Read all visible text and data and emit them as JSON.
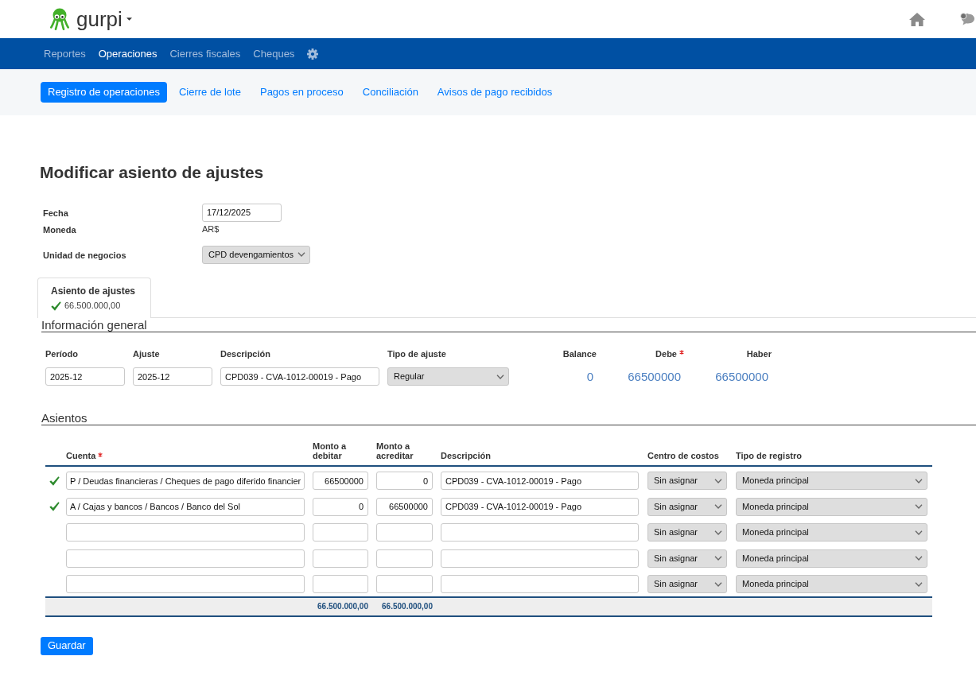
{
  "header": {
    "brand": "gurpi"
  },
  "main_nav": [
    {
      "label": "Reportes",
      "selected": false
    },
    {
      "label": "Operaciones",
      "selected": true
    },
    {
      "label": "Cierres fiscales",
      "selected": false
    },
    {
      "label": "Cheques",
      "selected": false
    }
  ],
  "sub_nav": [
    {
      "label": "Registro de operaciones",
      "selected": true
    },
    {
      "label": "Cierre de lote",
      "selected": false
    },
    {
      "label": "Pagos en proceso",
      "selected": false
    },
    {
      "label": "Conciliación",
      "selected": false
    },
    {
      "label": "Avisos de pago recibidos",
      "selected": false
    }
  ],
  "page_title": "Modificar asiento de ajustes",
  "form_fields": [
    {
      "kind": "input",
      "label": "Fecha",
      "value": "17/12/2025"
    },
    {
      "kind": "text",
      "label": "Moneda",
      "value": "AR$"
    },
    {
      "kind": "select",
      "label": "Unidad de negocios",
      "value": "CPD devengamientos"
    }
  ],
  "entry_tabs": [
    {
      "title": "Asiento de ajustes",
      "amount": "66.500.000,00",
      "valid": true,
      "selected": true
    }
  ],
  "general_info": {
    "title": "Información general",
    "fields": [
      {
        "kind": "input",
        "label": "Período",
        "value": "2025-12"
      },
      {
        "kind": "input",
        "label": "Ajuste",
        "value": "2025-12"
      },
      {
        "kind": "input",
        "label": "Descripción",
        "value": "CPD039 - CVA-1012-00019 - Pago"
      },
      {
        "kind": "select",
        "label": "Tipo de ajuste",
        "value": "Regular"
      }
    ],
    "totals": [
      {
        "label": "Balance",
        "value": "0",
        "required": false
      },
      {
        "label": "Debe",
        "value": "66500000",
        "required": true
      },
      {
        "label": "Haber",
        "value": "66500000",
        "required": false
      }
    ]
  },
  "entries": {
    "title": "Asientos",
    "columns": [
      {
        "label": "Cuenta",
        "required": true
      },
      {
        "label": "Monto a debitar",
        "required": false
      },
      {
        "label": "Monto a acreditar",
        "required": false
      },
      {
        "label": "Descripción",
        "required": false
      },
      {
        "label": "Centro de costos",
        "required": false
      },
      {
        "label": "Tipo de registro",
        "required": false
      }
    ],
    "rows": [
      {
        "valid": true,
        "account": "P / Deudas financieras / Cheques de pago diferido financier",
        "debit": "66500000",
        "credit": "0",
        "description": "CPD039 - CVA-1012-00019 - Pago",
        "cost_center": "Sin asignar",
        "record_type": "Moneda principal"
      },
      {
        "valid": true,
        "account": "A / Cajas y bancos / Bancos / Banco del Sol",
        "debit": "0",
        "credit": "66500000",
        "description": "CPD039 - CVA-1012-00019 - Pago",
        "cost_center": "Sin asignar",
        "record_type": "Moneda principal"
      },
      {
        "valid": false,
        "cost_center": "Sin asignar",
        "record_type": "Moneda principal"
      },
      {
        "valid": false,
        "cost_center": "Sin asignar",
        "record_type": "Moneda principal"
      },
      {
        "valid": false,
        "cost_center": "Sin asignar",
        "record_type": "Moneda principal"
      }
    ],
    "totals": {
      "debit": "66.500.000,00",
      "credit": "66.500.000,00"
    }
  },
  "save_button": "Guardar"
}
